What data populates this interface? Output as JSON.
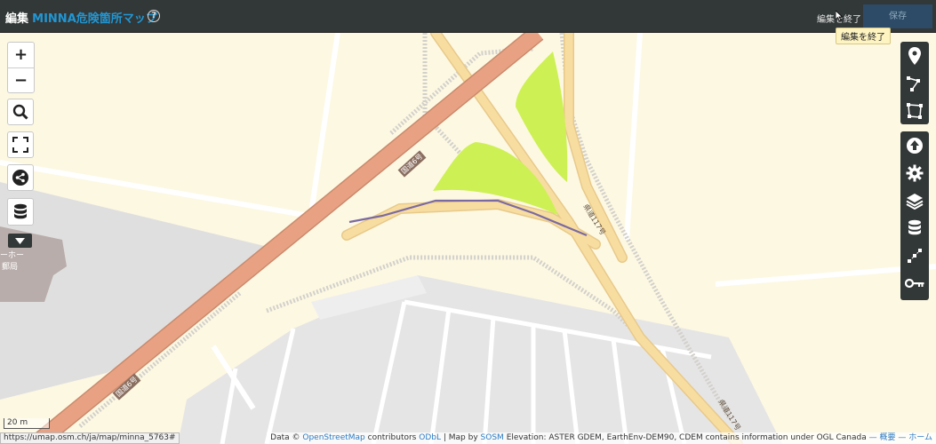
{
  "header": {
    "edit_prefix": "編集",
    "map_name": "MINNA危険箇所マップ",
    "help_label": "?",
    "end_edit_label": "編集を終了",
    "save_label": "保存"
  },
  "tooltip": {
    "text": "編集を終了"
  },
  "map_controls": {
    "zoom_in": "+",
    "zoom_out": "−"
  },
  "map_labels": {
    "road_label_1": "国道6号",
    "road_label_2": "国道6号",
    "road_label_3": "県道117号",
    "road_label_4": "県道117号",
    "building_label": "ーホー",
    "building_label_2": "郵局"
  },
  "right_toolbar": {
    "icons": [
      "marker-icon",
      "polyline-icon",
      "polygon-icon",
      "upload-icon",
      "settings-icon",
      "layers-icon",
      "datalayers-icon",
      "center-icon",
      "key-icon"
    ]
  },
  "scale": {
    "label": "20 m"
  },
  "status_url": "https://umap.osm.ch/ja/map/minna_5763#",
  "attribution": {
    "prefix": "Data ©",
    "osm": "OpenStreetMap",
    "contributors": "contributors",
    "odbl": "ODbL",
    "sep1": "| Map by",
    "sosm": "SOSM",
    "elevation": "Elevation: ASTER GDEM, EarthEnv-DEM90, CDEM contains information under OGL Canada",
    "dash1": "—",
    "about": "概要",
    "dash2": "—",
    "home": "ホーム"
  },
  "colors": {
    "header_bg": "#323737",
    "map_bg": "#fdf8e2",
    "primary_road": "#e8a283",
    "secondary_road": "#f8dda1",
    "grass": "#cdf054",
    "route_line": "#7b6aa1",
    "accent": "#2196d3"
  }
}
